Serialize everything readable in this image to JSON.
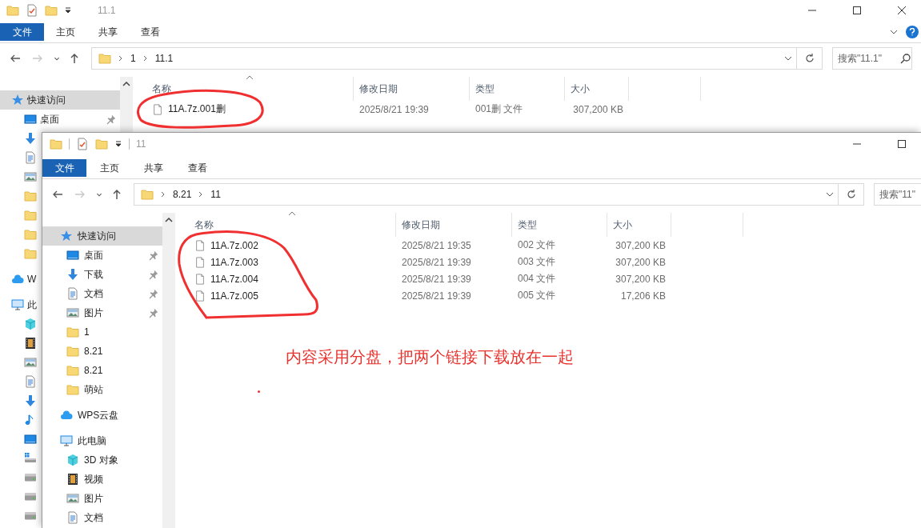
{
  "windows": [
    {
      "title": "11.1",
      "controls": [
        {
          "kind": "minimize"
        },
        {
          "kind": "maximize"
        },
        {
          "kind": "close"
        }
      ],
      "help": true,
      "tabs": [
        {
          "label": "文件",
          "kind": "file"
        },
        {
          "label": "主页",
          "kind": "tab"
        },
        {
          "label": "共享",
          "kind": "tab"
        },
        {
          "label": "查看",
          "kind": "tab"
        }
      ],
      "nav_buttons": [
        {
          "kind": "back",
          "disabled": false
        },
        {
          "kind": "forward",
          "disabled": true
        },
        {
          "kind": "recent",
          "disabled": false
        },
        {
          "kind": "up",
          "disabled": false
        }
      ],
      "path": [
        "1",
        "11.1"
      ],
      "search": {
        "placeholder": "搜索\"11.1\"",
        "button": true
      },
      "columns": [
        {
          "label": "名称",
          "sorted": true
        },
        {
          "label": "修改日期",
          "sorted": false
        },
        {
          "label": "类型",
          "sorted": false
        },
        {
          "label": "大小",
          "sorted": false
        }
      ],
      "files": [
        {
          "name": "11A.7z.001删",
          "date": "2025/8/21 19:39",
          "type": "001删 文件",
          "size": "307,200 KB"
        }
      ],
      "nav": [
        {
          "label": "快速访问",
          "kind": "star",
          "selected": true,
          "children": [
            {
              "label": "桌面",
              "kind": "desktop",
              "selected": false,
              "pinned": true
            },
            {
              "kind": "download",
              "selected": false
            },
            {
              "kind": "document",
              "selected": false
            },
            {
              "kind": "picture",
              "selected": false
            },
            {
              "kind": "folder",
              "selected": false
            },
            {
              "kind": "folder",
              "selected": false
            },
            {
              "kind": "folder",
              "selected": false
            },
            {
              "kind": "folder",
              "selected": false
            }
          ]
        },
        {
          "label": "W",
          "kind": "cloud",
          "selected": false
        },
        {
          "label": "此",
          "kind": "pc",
          "selected": false,
          "children": [
            {
              "kind": "cube",
              "selected": false
            },
            {
              "kind": "film",
              "selected": false
            },
            {
              "kind": "picture",
              "selected": false
            },
            {
              "kind": "document",
              "selected": false
            },
            {
              "kind": "download",
              "selected": false
            },
            {
              "kind": "music",
              "selected": false
            },
            {
              "kind": "desktop",
              "selected": false
            },
            {
              "kind": "systemdrive",
              "selected": false
            },
            {
              "kind": "drive",
              "selected": false
            },
            {
              "kind": "drive",
              "selected": false
            },
            {
              "kind": "drive",
              "selected": false
            }
          ]
        }
      ]
    },
    {
      "title": "11",
      "controls": [
        {
          "kind": "minimize"
        },
        {
          "kind": "maximize"
        }
      ],
      "help": false,
      "tabs": [
        {
          "label": "文件",
          "kind": "file"
        },
        {
          "label": "主页",
          "kind": "tab"
        },
        {
          "label": "共享",
          "kind": "tab"
        },
        {
          "label": "查看",
          "kind": "tab"
        }
      ],
      "nav_buttons": [
        {
          "kind": "back",
          "disabled": false
        },
        {
          "kind": "forward",
          "disabled": true
        },
        {
          "kind": "recent",
          "disabled": false
        },
        {
          "kind": "up",
          "disabled": false
        }
      ],
      "path": [
        "8.21",
        "11"
      ],
      "search": {
        "placeholder": "搜索\"11\"",
        "button": false
      },
      "columns": [
        {
          "label": "名称",
          "sorted": true
        },
        {
          "label": "修改日期",
          "sorted": false
        },
        {
          "label": "类型",
          "sorted": false
        },
        {
          "label": "大小",
          "sorted": false
        }
      ],
      "files": [
        {
          "name": "11A.7z.002",
          "date": "2025/8/21 19:35",
          "type": "002 文件",
          "size": "307,200 KB"
        },
        {
          "name": "11A.7z.003",
          "date": "2025/8/21 19:39",
          "type": "003 文件",
          "size": "307,200 KB"
        },
        {
          "name": "11A.7z.004",
          "date": "2025/8/21 19:39",
          "type": "004 文件",
          "size": "307,200 KB"
        },
        {
          "name": "11A.7z.005",
          "date": "2025/8/21 19:39",
          "type": "005 文件",
          "size": "17,206 KB"
        }
      ],
      "nav": [
        {
          "label": "快速访问",
          "kind": "star",
          "selected": true,
          "children": [
            {
              "label": "桌面",
              "kind": "desktop",
              "selected": false,
              "pinned": true
            },
            {
              "label": "下载",
              "kind": "download",
              "selected": false,
              "pinned": true
            },
            {
              "label": "文档",
              "kind": "document",
              "selected": false,
              "pinned": true
            },
            {
              "label": "图片",
              "kind": "picture",
              "selected": false,
              "pinned": true
            },
            {
              "label": "1",
              "kind": "folder",
              "selected": false,
              "pinned": false
            },
            {
              "label": "8.21",
              "kind": "folder",
              "selected": false,
              "pinned": false
            },
            {
              "label": "8.21",
              "kind": "folder",
              "selected": false,
              "pinned": false
            },
            {
              "label": "萌站",
              "kind": "folder",
              "selected": false,
              "pinned": false
            }
          ]
        },
        {
          "label": "WPS云盘",
          "kind": "cloud",
          "selected": false
        },
        {
          "label": "此电脑",
          "kind": "pc",
          "selected": false,
          "children": [
            {
              "label": "3D 对象",
              "kind": "cube",
              "selected": false
            },
            {
              "label": "视频",
              "kind": "film",
              "selected": false
            },
            {
              "label": "图片",
              "kind": "picture",
              "selected": false
            },
            {
              "label": "文档",
              "kind": "document",
              "selected": false
            }
          ]
        }
      ]
    }
  ],
  "annotation": {
    "note": "内容采用分盘，把两个链接下载放在一起"
  }
}
